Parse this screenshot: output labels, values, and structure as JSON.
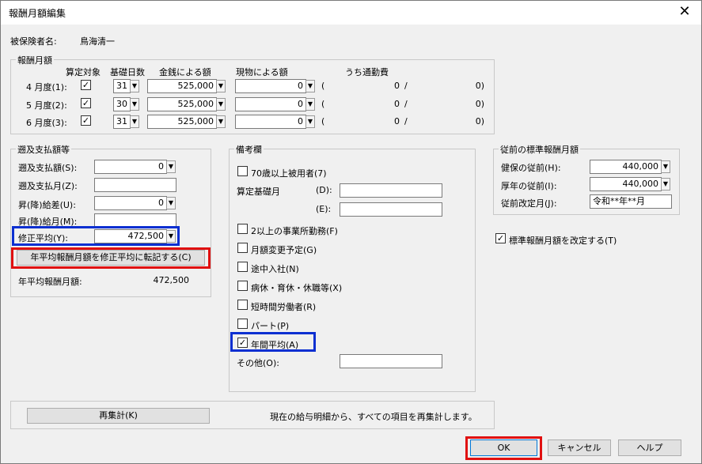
{
  "window": {
    "title": "報酬月額編集",
    "close_icon": "close-icon"
  },
  "insured": {
    "label": "被保険者名:",
    "name": "鳥海清一"
  },
  "monthly": {
    "group_label": "報酬月額",
    "headers": {
      "target": "算定対象",
      "days": "基礎日数",
      "cash": "金銭による額",
      "kind": "現物による額",
      "commute": "うち通勤費"
    },
    "rows": [
      {
        "label": "4 月度(1):",
        "checked": true,
        "days": "31",
        "cash": "525,000",
        "kind": "0",
        "paren_open": "(",
        "commute_a": "0",
        "slash": "/",
        "commute_b": "0)"
      },
      {
        "label": "5 月度(2):",
        "checked": true,
        "days": "30",
        "cash": "525,000",
        "kind": "0",
        "paren_open": "(",
        "commute_a": "0",
        "slash": "/",
        "commute_b": "0)"
      },
      {
        "label": "6 月度(3):",
        "checked": true,
        "days": "31",
        "cash": "525,000",
        "kind": "0",
        "paren_open": "(",
        "commute_a": "0",
        "slash": "/",
        "commute_b": "0)"
      }
    ]
  },
  "retro": {
    "group_label": "遡及支払額等",
    "retro_amount_label": "遡及支払額(S):",
    "retro_amount_value": "0",
    "retro_month_label": "遡及支払月(Z):",
    "retro_month_value": "",
    "raise_diff_label": "昇(降)給差(U):",
    "raise_diff_value": "0",
    "raise_month_label": "昇(降)給月(M):",
    "raise_month_value": "",
    "corrected_avg_label": "修正平均(Y):",
    "corrected_avg_value": "472,500",
    "transfer_button": "年平均報酬月額を修正平均に転記する(C)",
    "annual_avg_label": "年平均報酬月額:",
    "annual_avg_value": "472,500"
  },
  "remarks": {
    "group_label": "備考欄",
    "over70": {
      "label": "70歳以上被用者(7)",
      "checked": false
    },
    "calc_base_month_label": "算定基礎月",
    "d_label": "(D):",
    "e_label": "(E):",
    "multi_office": {
      "label": "2以上の事業所勤務(F)",
      "checked": false
    },
    "planned_change": {
      "label": "月額変更予定(G)",
      "checked": false
    },
    "mid_join": {
      "label": "途中入社(N)",
      "checked": false
    },
    "leave": {
      "label": "病休・育休・休職等(X)",
      "checked": false
    },
    "short_time": {
      "label": "短時間労働者(R)",
      "checked": false
    },
    "part": {
      "label": "パート(P)",
      "checked": false
    },
    "annual_avg": {
      "label": "年間平均(A)",
      "checked": true
    },
    "other_label": "その他(O):",
    "other_value": ""
  },
  "previous": {
    "group_label": "従前の標準報酬月額",
    "health_label": "健保の従前(H):",
    "health_value": "440,000",
    "pension_label": "厚年の従前(I):",
    "pension_value": "440,000",
    "revision_label": "従前改定月(J):",
    "revision_value": "令和**年**月"
  },
  "revise_standard": {
    "label": "標準報酬月額を改定する(T)",
    "checked": true
  },
  "recalc": {
    "button": "再集計(K)",
    "description": "現在の給与明細から、すべての項目を再集計します。"
  },
  "footer": {
    "ok": "OK",
    "cancel": "キャンセル",
    "help": "ヘルプ"
  },
  "colors": {
    "highlight_blue": "#0b2fd1",
    "highlight_red": "#e01010"
  }
}
